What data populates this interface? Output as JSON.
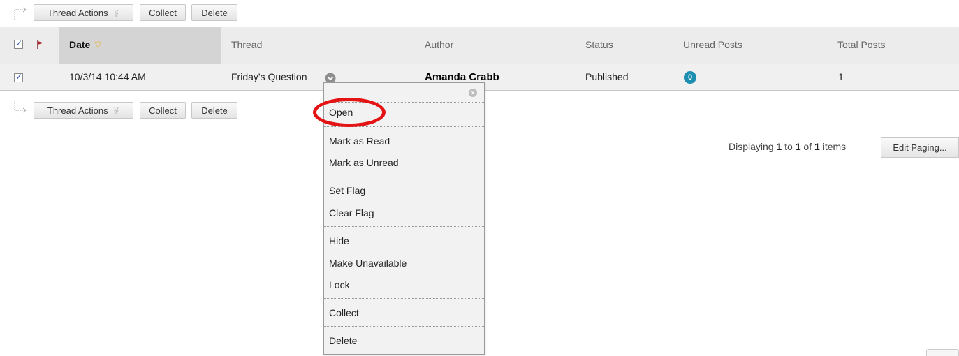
{
  "action_bar": {
    "thread_actions": "Thread Actions",
    "thread_actions_chevron": "≫",
    "collect": "Collect",
    "delete": "Delete"
  },
  "table": {
    "columns": [
      "Date",
      "Thread",
      "Author",
      "Status",
      "Unread Posts",
      "Total Posts"
    ],
    "sort_indicator": "▽",
    "rows": [
      {
        "date": "10/3/14 10:44 AM",
        "thread": "Friday's Question",
        "author": "Amanda Crabb",
        "status": "Published",
        "unread": "0",
        "total": "1"
      }
    ]
  },
  "paging": {
    "prefix": "Displaying ",
    "from": "1",
    "to_word": " to ",
    "to": "1",
    "of_word": " of ",
    "total": "1",
    "suffix": " items",
    "edit_label": "Edit Paging..."
  },
  "context_menu": {
    "close_glyph": "×",
    "items": [
      "Open",
      "Mark as Read",
      "Mark as Unread",
      "Set Flag",
      "Clear Flag",
      "Hide",
      "Make Unavailable",
      "Lock",
      "Collect",
      "Delete"
    ]
  },
  "colors": {
    "header_bg": "#ececec",
    "sorted_header_bg": "#d4d4d4",
    "badge": "#1c8fb0",
    "highlight_ring": "#e41414",
    "flag": "#b0262a"
  },
  "icons": {
    "header_flag": "flag-icon",
    "row_menu": "chevron-down-circle-icon",
    "action_arrow": "connector-arrow-icon"
  }
}
